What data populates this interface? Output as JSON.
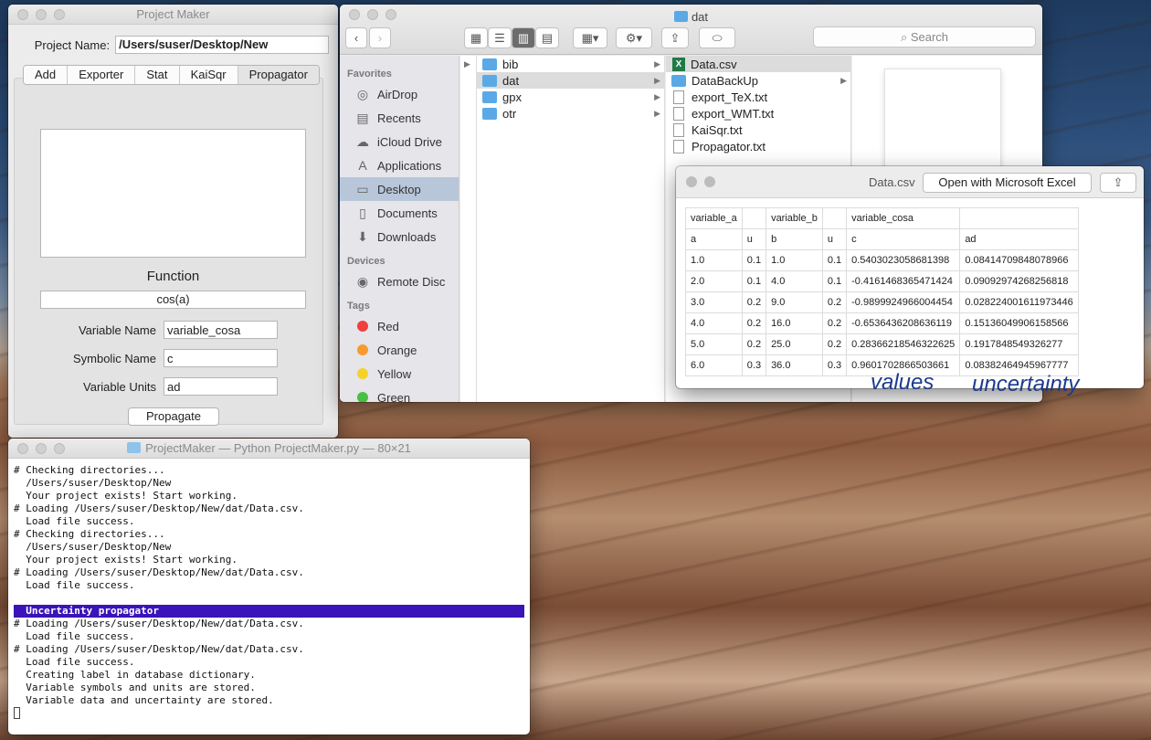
{
  "project_maker": {
    "title": "Project Maker",
    "name_label": "Project Name:",
    "name_value": "/Users/suser/Desktop/New",
    "tabs": [
      "Add",
      "Exporter",
      "Stat",
      "KaiSqr",
      "Propagator"
    ],
    "function_label": "Function",
    "function_value": "cos(a)",
    "variable_name_label": "Variable Name",
    "variable_name_value": "variable_cosa",
    "symbolic_name_label": "Symbolic Name",
    "symbolic_name_value": "c",
    "variable_units_label": "Variable Units",
    "variable_units_value": "ad",
    "propagate_label": "Propagate"
  },
  "finder": {
    "title": "dat",
    "search_placeholder": "Search",
    "sidebar": {
      "favorites_header": "Favorites",
      "favorites": [
        {
          "label": "AirDrop",
          "icon": "airdrop-icon"
        },
        {
          "label": "Recents",
          "icon": "recents-icon"
        },
        {
          "label": "iCloud Drive",
          "icon": "cloud-icon"
        },
        {
          "label": "Applications",
          "icon": "applications-icon"
        },
        {
          "label": "Desktop",
          "icon": "desktop-icon"
        },
        {
          "label": "Documents",
          "icon": "documents-icon"
        },
        {
          "label": "Downloads",
          "icon": "downloads-icon"
        }
      ],
      "devices_header": "Devices",
      "devices": [
        {
          "label": "Remote Disc",
          "icon": "disc-icon"
        }
      ],
      "tags_header": "Tags",
      "tags": [
        {
          "label": "Red",
          "color": "#f0403d"
        },
        {
          "label": "Orange",
          "color": "#f79b2e"
        },
        {
          "label": "Yellow",
          "color": "#f5d22a"
        },
        {
          "label": "Green",
          "color": "#46c043"
        }
      ]
    },
    "column1": [
      "bib",
      "dat",
      "gpx",
      "otr"
    ],
    "column2": [
      {
        "label": "Data.csv",
        "kind": "xls"
      },
      {
        "label": "DataBackUp",
        "kind": "folder"
      },
      {
        "label": "export_TeX.txt",
        "kind": "doc"
      },
      {
        "label": "export_WMT.txt",
        "kind": "doc"
      },
      {
        "label": "KaiSqr.txt",
        "kind": "doc"
      },
      {
        "label": "Propagator.txt",
        "kind": "doc"
      }
    ]
  },
  "quicklook": {
    "title": "Data.csv",
    "open_label": "Open with Microsoft Excel",
    "rows": [
      [
        "variable_a",
        "",
        "variable_b",
        "",
        "variable_cosa",
        ""
      ],
      [
        "a",
        "u",
        "b",
        "u",
        "c",
        "ad"
      ],
      [
        "1.0",
        "0.1",
        "1.0",
        "0.1",
        "0.5403023058681398",
        "0.08414709848078966"
      ],
      [
        "2.0",
        "0.1",
        "4.0",
        "0.1",
        "-0.4161468365471424",
        "0.09092974268256818"
      ],
      [
        "3.0",
        "0.2",
        "9.0",
        "0.2",
        "-0.9899924966004454",
        "0.028224001611973446"
      ],
      [
        "4.0",
        "0.2",
        "16.0",
        "0.2",
        "-0.6536436208636119",
        "0.15136049906158566"
      ],
      [
        "5.0",
        "0.2",
        "25.0",
        "0.2",
        "0.28366218546322625",
        "0.1917848549326277"
      ],
      [
        "6.0",
        "0.3",
        "36.0",
        "0.3",
        "0.9601702866503661",
        "0.08382464945967777"
      ]
    ],
    "annotation_values": "values",
    "annotation_uncertainty": "uncertainty"
  },
  "terminal": {
    "title": "ProjectMaker — Python ProjectMaker.py — 80×21",
    "lines_before": [
      "# Checking directories...",
      "  /Users/suser/Desktop/New",
      "  Your project exists! Start working.",
      "# Loading /Users/suser/Desktop/New/dat/Data.csv.",
      "  Load file success.",
      "# Checking directories...",
      "  /Users/suser/Desktop/New",
      "  Your project exists! Start working.",
      "# Loading /Users/suser/Desktop/New/dat/Data.csv.",
      "  Load file success.",
      ""
    ],
    "highlight": "  Uncertainty propagator",
    "lines_after": [
      "# Loading /Users/suser/Desktop/New/dat/Data.csv.",
      "  Load file success.",
      "# Loading /Users/suser/Desktop/New/dat/Data.csv.",
      "  Load file success.",
      "  Creating label in database dictionary.",
      "  Variable symbols and units are stored.",
      "  Variable data and uncertainty are stored."
    ]
  }
}
